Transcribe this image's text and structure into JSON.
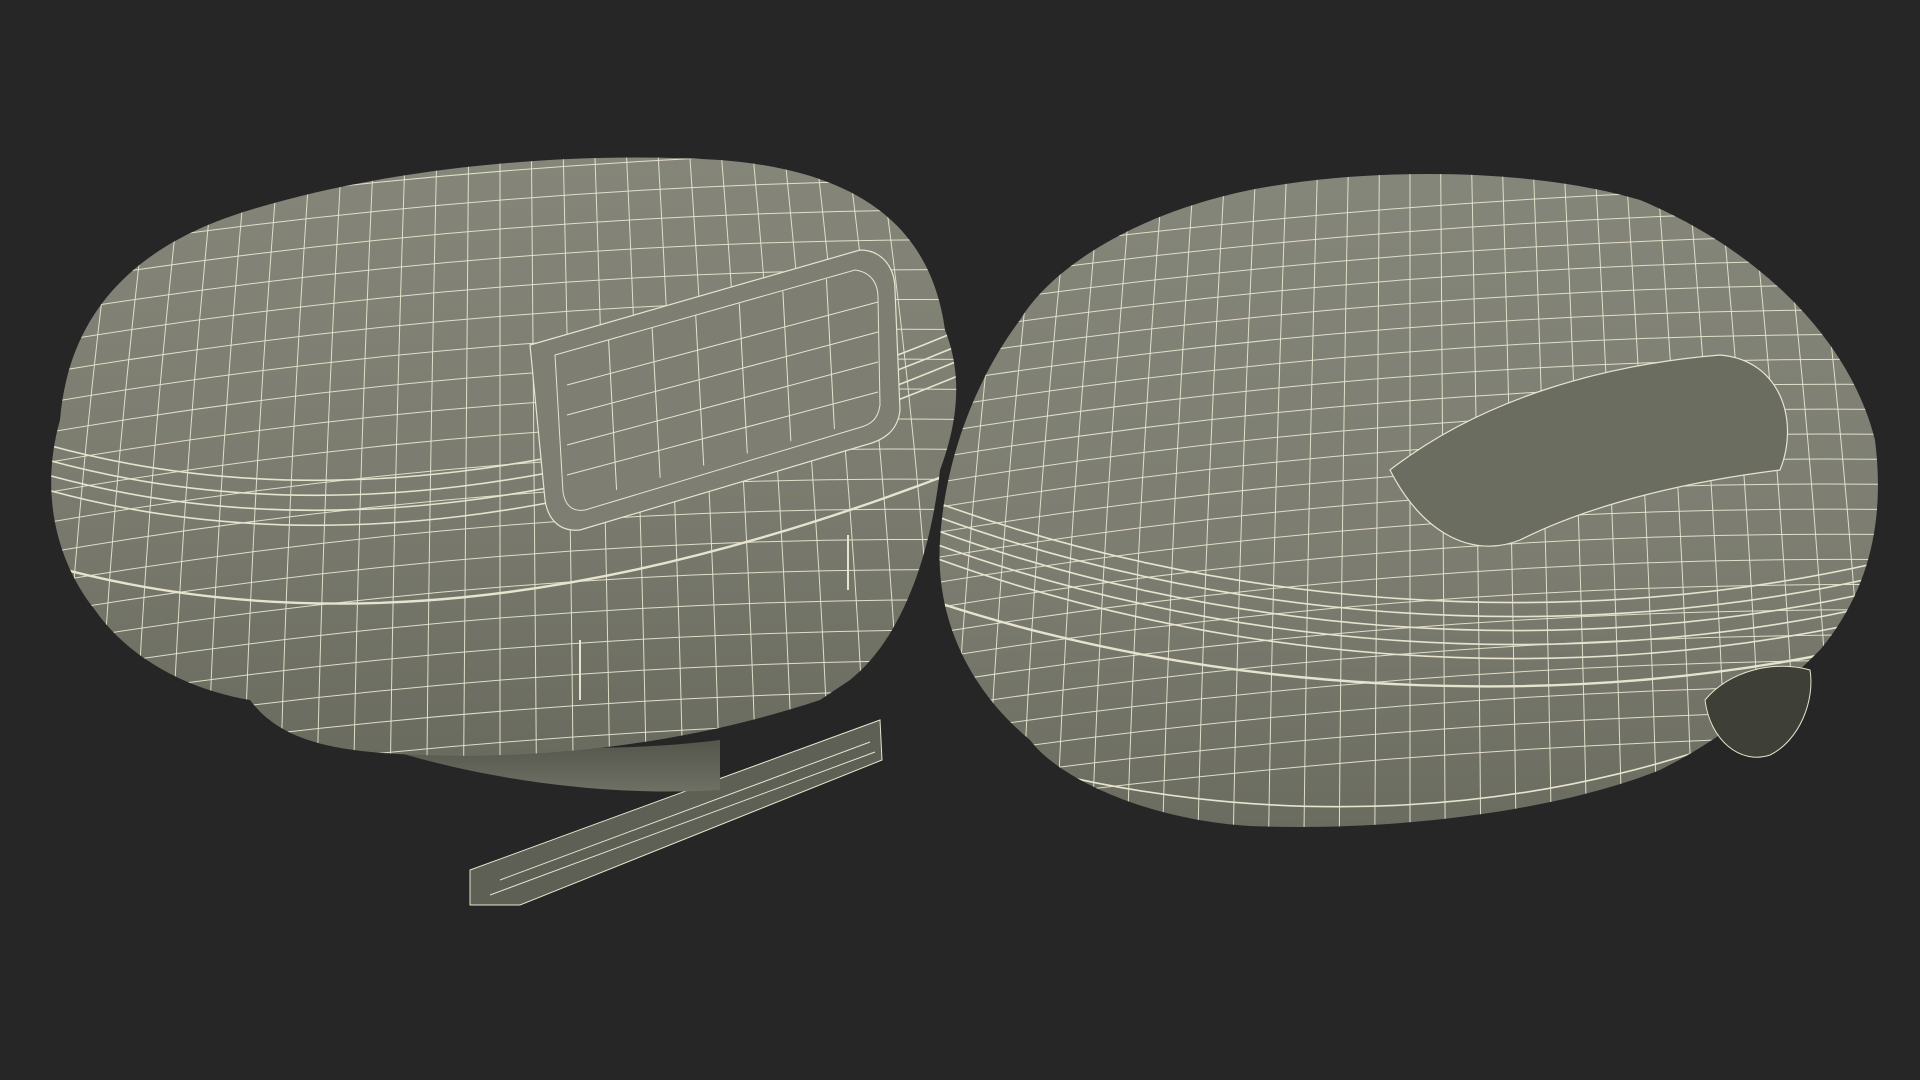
{
  "scene": {
    "background_color": "#262626",
    "shell_color": "#7c7d70",
    "shell_shadow_color": "#4a4b41",
    "shell_dark_color": "#2f302a",
    "wire_color": "#e6e4cf",
    "objects": [
      {
        "name": "top-case-rear-view"
      },
      {
        "name": "top-case-front-view"
      }
    ]
  }
}
